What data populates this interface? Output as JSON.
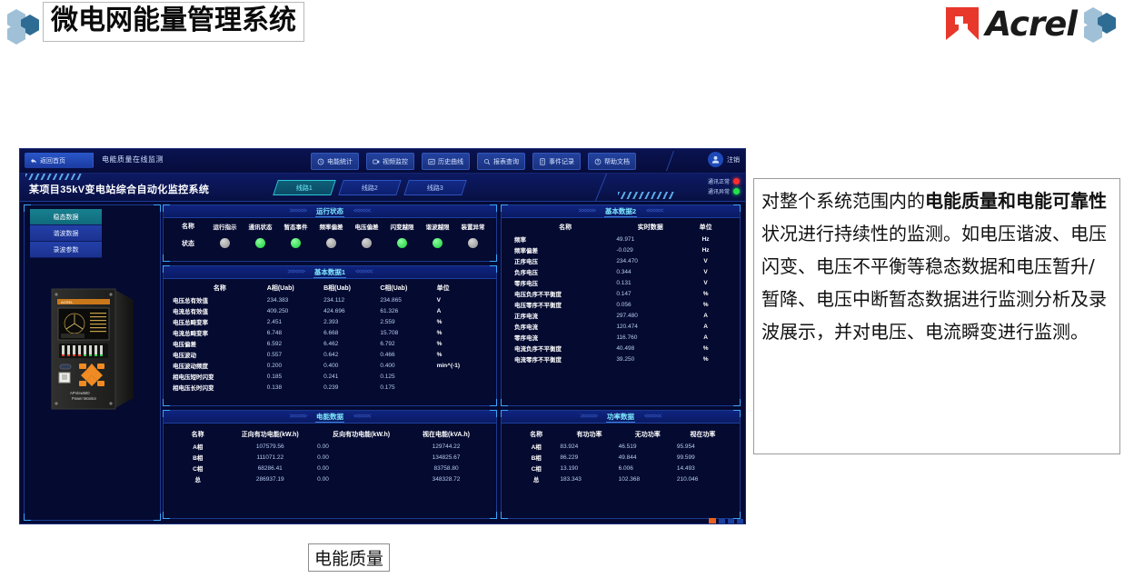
{
  "page": {
    "title": "微电网能量管理系统",
    "brand": "Acrel",
    "caption": "电能质量"
  },
  "description": {
    "part1": "对整个系统范围内的",
    "bold1": "电能质量和电能可靠性",
    "part2": "状况进行持续性的监测。如电压谐波、电压闪变、电压不平衡等稳态数据和电压暂升/暂降、电压中断暂态数据进行监测分析及录波展示，并对电压、电流瞬变进行监测。"
  },
  "app": {
    "topnav": {
      "back_label": "返回首页",
      "page_subtitle": "电能质量在线监测",
      "actions": [
        {
          "label": "电能统计",
          "icon": "clock-icon"
        },
        {
          "label": "视频监控",
          "icon": "video-icon"
        },
        {
          "label": "历史曲线",
          "icon": "chart-icon"
        },
        {
          "label": "报表查询",
          "icon": "search-icon"
        },
        {
          "label": "事件记录",
          "icon": "document-icon"
        },
        {
          "label": "帮助文档",
          "icon": "help-icon"
        }
      ],
      "user_label": "注销"
    },
    "titleband": {
      "station_title": "某项目35kV变电站综合自动化监控系统",
      "tabs": [
        {
          "label": "线路1",
          "active": true
        },
        {
          "label": "线路2",
          "active": false
        },
        {
          "label": "线路3",
          "active": false
        }
      ],
      "comm": [
        {
          "label": "通讯正常",
          "color": "#ff2d2d"
        },
        {
          "label": "通讯异常",
          "color": "#23e04a"
        }
      ]
    },
    "sidebar": {
      "items": [
        {
          "label": "稳态数据",
          "active": true
        },
        {
          "label": "谐波数据",
          "active": false
        },
        {
          "label": "录波参数",
          "active": false
        }
      ]
    },
    "device": {
      "model": "APView500",
      "subtitle": "Power Monitor"
    },
    "panel_status": {
      "title": "运行状态",
      "row_labels": [
        "名称",
        "状态"
      ],
      "columns": [
        "运行指示",
        "通讯状态",
        "暂态事件",
        "频率偏差",
        "电压偏差",
        "闪变越限",
        "谐波越限",
        "装置异常"
      ],
      "lamps": [
        "off",
        "on",
        "on",
        "off",
        "off",
        "on",
        "on",
        "off"
      ]
    },
    "panel_basic1": {
      "title": "基本数据1",
      "headers": [
        "名称",
        "A相(Uab)",
        "B相(Uab)",
        "C相(Uab)",
        "单位"
      ],
      "rows": [
        [
          "电压总有效值",
          "234.383",
          "234.112",
          "234.865",
          "V"
        ],
        [
          "电流总有效值",
          "409.250",
          "424.696",
          "61.326",
          "A"
        ],
        [
          "电压总畸变率",
          "2.451",
          "2.393",
          "2.559",
          "%"
        ],
        [
          "电流总畸变率",
          "6.748",
          "6.668",
          "15.708",
          "%"
        ],
        [
          "电压偏差",
          "6.592",
          "6.462",
          "6.792",
          "%"
        ],
        [
          "电压波动",
          "0.557",
          "0.642",
          "0.466",
          "%"
        ],
        [
          "电压波动频度",
          "0.200",
          "0.400",
          "0.400",
          "min^(-1)"
        ],
        [
          "相电压短时闪变",
          "0.185",
          "0.241",
          "0.125",
          ""
        ],
        [
          "相电压长时闪变",
          "0.138",
          "0.239",
          "0.175",
          ""
        ]
      ]
    },
    "panel_basic2": {
      "title": "基本数据2",
      "headers": [
        "名称",
        "实时数据",
        "单位"
      ],
      "rows": [
        [
          "频率",
          "49.971",
          "Hz"
        ],
        [
          "频率偏差",
          "-0.029",
          "Hz"
        ],
        [
          "正序电压",
          "234.470",
          "V"
        ],
        [
          "负序电压",
          "0.344",
          "V"
        ],
        [
          "零序电压",
          "0.131",
          "V"
        ],
        [
          "电压负序不平衡度",
          "0.147",
          "%"
        ],
        [
          "电压零序不平衡度",
          "0.056",
          "%"
        ],
        [
          "正序电流",
          "297.480",
          "A"
        ],
        [
          "负序电流",
          "120.474",
          "A"
        ],
        [
          "零序电流",
          "116.760",
          "A"
        ],
        [
          "电流负序不平衡度",
          "40.498",
          "%"
        ],
        [
          "电流零序不平衡度",
          "39.250",
          "%"
        ]
      ]
    },
    "panel_energy": {
      "title": "电能数据",
      "headers": [
        "名称",
        "正向有功电能(kW.h)",
        "反向有功电能(kW.h)",
        "视在电能(kVA.h)"
      ],
      "rows": [
        [
          "A相",
          "107579.56",
          "0.00",
          "129744.22"
        ],
        [
          "B相",
          "111071.22",
          "0.00",
          "134825.67"
        ],
        [
          "C相",
          "68286.41",
          "0.00",
          "83758.80"
        ],
        [
          "总",
          "286937.19",
          "0.00",
          "348328.72"
        ]
      ]
    },
    "panel_power": {
      "title": "功率数据",
      "headers": [
        "名称",
        "有功功率",
        "无功功率",
        "视在功率"
      ],
      "rows": [
        [
          "A相",
          "83.924",
          "46.519",
          "95.954"
        ],
        [
          "B相",
          "86.229",
          "49.844",
          "99.599"
        ],
        [
          "C相",
          "13.190",
          "6.006",
          "14.493"
        ],
        [
          "总",
          "183.343",
          "102.368",
          "210.046"
        ]
      ]
    },
    "arrows": {
      "left": ">>>>>>",
      "right": "<<<<<<"
    }
  }
}
